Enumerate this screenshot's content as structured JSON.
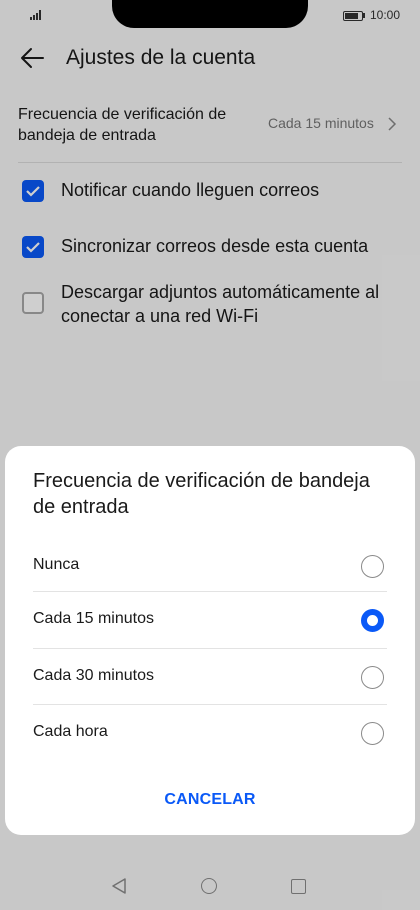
{
  "status_bar": {
    "time": "10:00"
  },
  "header": {
    "title": "Ajustes de la cuenta"
  },
  "settings": {
    "frequency": {
      "label": "Frecuencia de verificación de bandeja de entrada",
      "value": "Cada 15 minutos"
    },
    "options": [
      {
        "label": "Notificar cuando lleguen correos",
        "checked": true
      },
      {
        "label": "Sincronizar correos desde esta cuenta",
        "checked": true
      },
      {
        "label": "Descargar adjuntos automáticamente al conectar a una red Wi-Fi",
        "checked": false
      }
    ]
  },
  "dialog": {
    "title": "Frecuencia de verificación de bandeja de entrada",
    "options": [
      {
        "label": "Nunca",
        "selected": false
      },
      {
        "label": "Cada 15 minutos",
        "selected": true
      },
      {
        "label": "Cada 30 minutos",
        "selected": false
      },
      {
        "label": "Cada hora",
        "selected": false
      }
    ],
    "cancel_label": "CANCELAR"
  },
  "colors": {
    "accent": "#0a59f7"
  }
}
